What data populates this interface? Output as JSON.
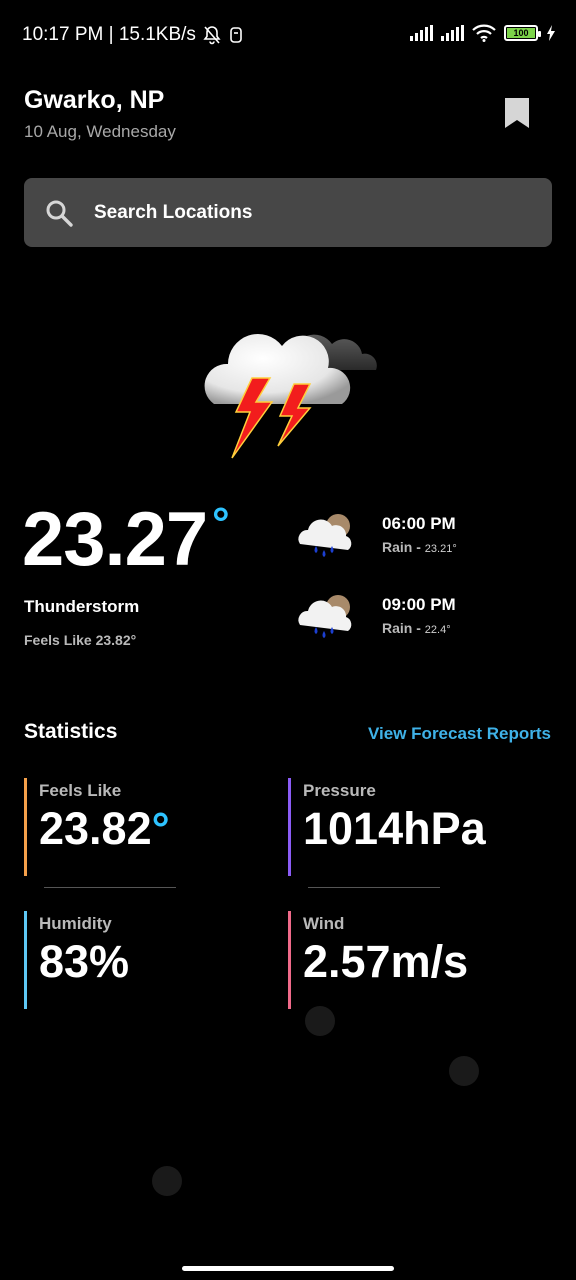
{
  "status_bar": {
    "time_and_speed": "10:17 PM | 15.1KB/s",
    "battery": "100"
  },
  "header": {
    "location": "Gwarko, NP",
    "date": "10 Aug, Wednesday"
  },
  "search": {
    "placeholder": "Search Locations"
  },
  "current": {
    "temperature": "23.27",
    "degree_symbol": "°",
    "condition": "Thunderstorm",
    "feels_like": "Feels Like 23.82°"
  },
  "hourly": [
    {
      "time": "06:00 PM",
      "label": "Rain",
      "sep": " - ",
      "temp": "23.21°"
    },
    {
      "time": "09:00 PM",
      "label": "Rain",
      "sep": " - ",
      "temp": "22.4°"
    }
  ],
  "statistics": {
    "title": "Statistics",
    "link": "View Forecast Reports",
    "items": [
      {
        "label": "Feels Like",
        "value": "23.82",
        "unit": "°",
        "color": "#f5a04a"
      },
      {
        "label": "Pressure",
        "value": "1014hPa",
        "unit": "",
        "color": "#8b5cf6"
      },
      {
        "label": "Humidity",
        "value": "83%",
        "unit": "",
        "color": "#5ec8f5"
      },
      {
        "label": "Wind",
        "value": "2.57m/s",
        "unit": "",
        "color": "#f06a8a"
      }
    ]
  },
  "colors": {
    "accent": "#2ec3ff",
    "link": "#3fb2e8",
    "search_bg": "#474747"
  }
}
